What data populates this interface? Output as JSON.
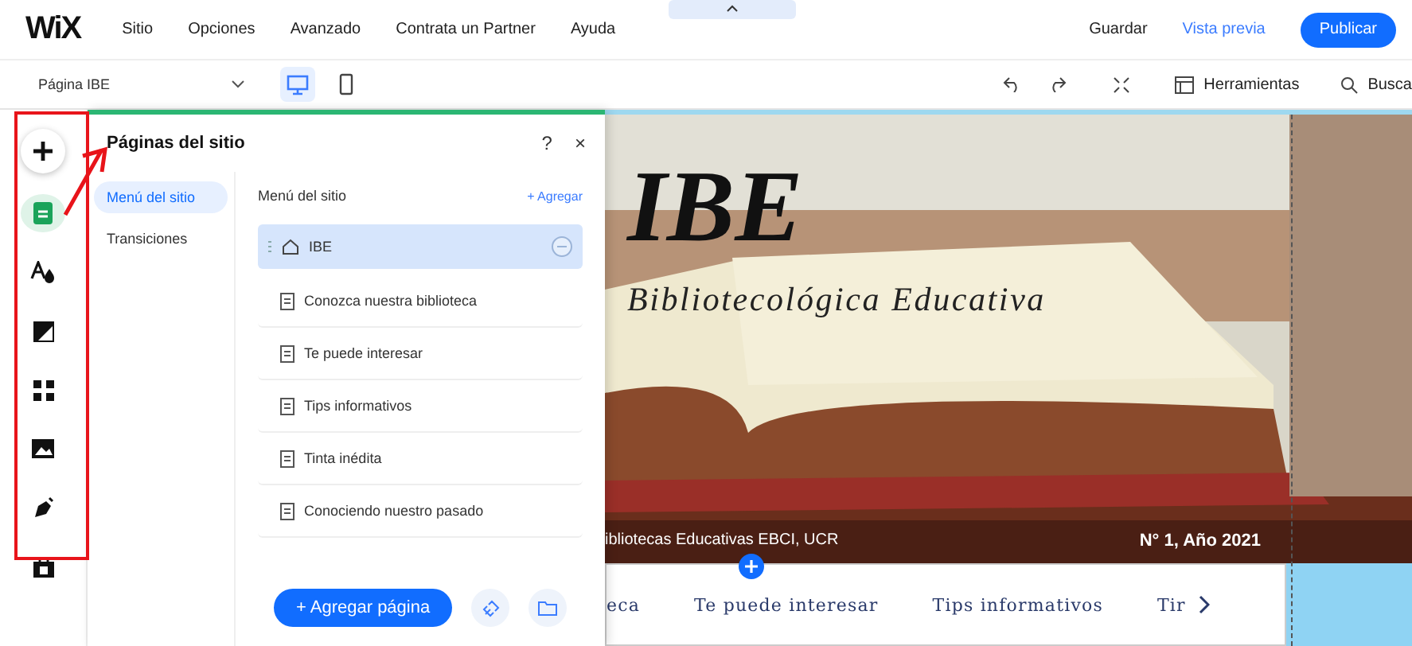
{
  "logo": "WiX",
  "menu": [
    "Sitio",
    "Opciones",
    "Avanzado",
    "Contrata un Partner",
    "Ayuda"
  ],
  "actions": {
    "save": "Guardar",
    "preview": "Vista previa",
    "publish": "Publicar"
  },
  "toolbar": {
    "page": "Página IBE",
    "devices": [
      {
        "kind": "desktop",
        "selected": true
      },
      {
        "kind": "mobile",
        "selected": false
      }
    ],
    "tools": "Herramientas",
    "search": "Busca"
  },
  "rail": [
    {
      "kind": "add",
      "selected": false
    },
    {
      "kind": "pages",
      "selected": true
    },
    {
      "kind": "theme",
      "selected": false
    },
    {
      "kind": "background",
      "selected": false
    },
    {
      "kind": "apps",
      "selected": false
    },
    {
      "kind": "media",
      "selected": false
    },
    {
      "kind": "blog",
      "selected": false
    },
    {
      "kind": "market",
      "selected": false
    }
  ],
  "panel": {
    "title": "Páginas del sitio",
    "help": "?",
    "close": "×",
    "tabs": [
      {
        "label": "Menú del sitio",
        "selected": true
      },
      {
        "label": "Transiciones",
        "selected": false
      }
    ],
    "list_title": "Menú del sitio",
    "add_link": "+ Agregar",
    "pages": [
      {
        "name": "IBE",
        "home": true,
        "selected": true
      },
      {
        "name": "Conozca nuestra biblioteca",
        "home": false,
        "selected": false
      },
      {
        "name": "Te puede interesar",
        "home": false,
        "selected": false
      },
      {
        "name": "Tips informativos",
        "home": false,
        "selected": false
      },
      {
        "name": "Tinta inédita",
        "home": false,
        "selected": false
      },
      {
        "name": "Conociendo nuestro pasado",
        "home": false,
        "selected": false
      }
    ],
    "add_page": "+ Agregar página"
  },
  "site": {
    "title": "IBE",
    "subtitle": "Bibliotecológica Educativa",
    "credit": "ibliotecas Educativas EBCI, UCR",
    "issue": "N° 1, Año 2021",
    "nav": [
      "eca",
      "Te puede interesar",
      "Tips informativos",
      "Tir"
    ]
  }
}
